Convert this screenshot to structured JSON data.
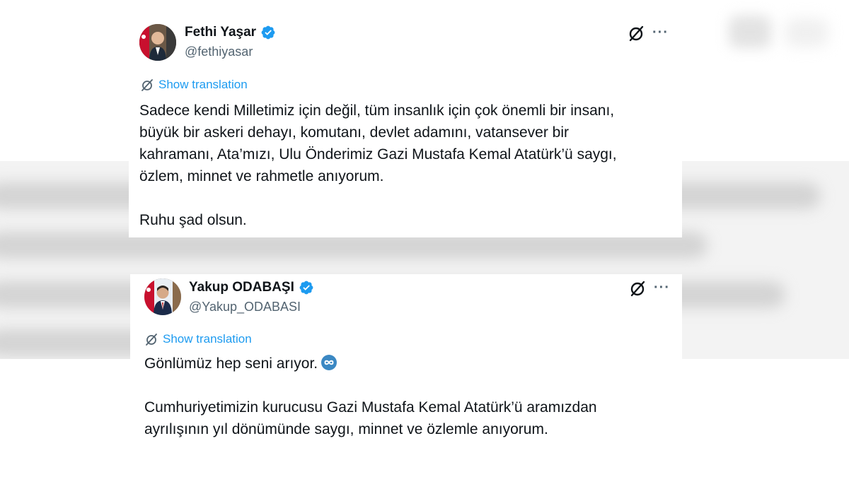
{
  "tweets": [
    {
      "name": "Fethi Yaşar",
      "handle": "@fethiyasar",
      "translate_label": "Show translation",
      "paragraphs": [
        "Sadece kendi Milletimiz için değil, tüm insanlık için çok önemli bir insanı,",
        "büyük bir askeri dehayı, komutanı, devlet adamını, vatansever bir",
        "kahramanı, Ata’mızı, Ulu Önderimiz Gazi Mustafa Kemal Atatürk’ü saygı,",
        "özlem, minnet ve rahmetle anıyorum.",
        "",
        "Ruhu şad olsun."
      ]
    },
    {
      "name": "Yakup ODABAŞI",
      "handle": "@Yakup_ODABASI",
      "translate_label": "Show translation",
      "paragraphs": [
        "Gönlümüz hep seni arıyor.",
        "",
        "Cumhuriyetimizin kurucusu Gazi Mustafa Kemal Atatürk’ü aramızdan",
        "ayrılışının yıl dönümünde saygı, minnet ve özlemle anıyorum."
      ]
    }
  ],
  "icons": {
    "verified": "verified-badge-icon",
    "grok": "grok-icon",
    "more": "more-icon",
    "translate": "translate-icon",
    "infinity": "infinity-emoji"
  },
  "more_glyph": "···",
  "colors": {
    "accent": "#1d9bf0",
    "text": "#0f1419",
    "muted": "#536471"
  }
}
